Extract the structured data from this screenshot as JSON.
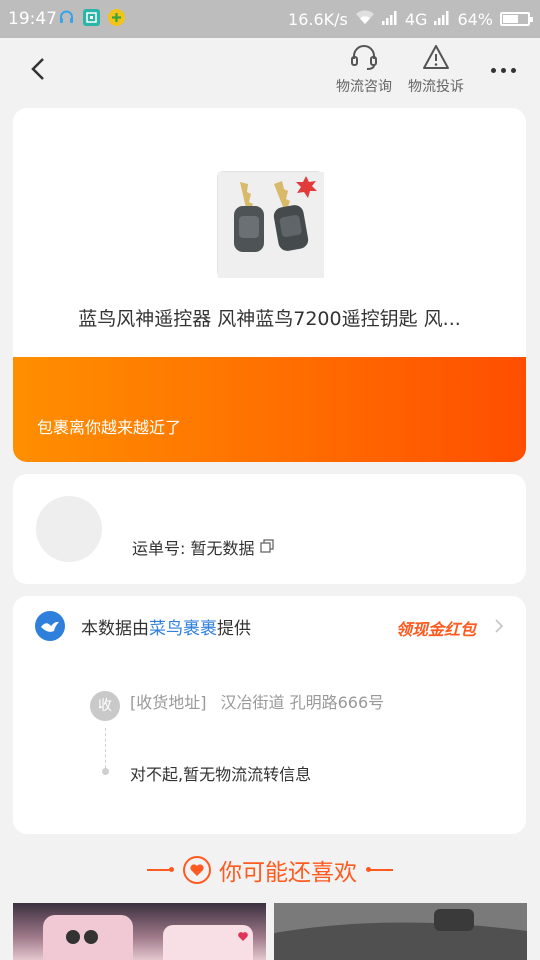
{
  "status_bar": {
    "time": "19:47",
    "speed": "16.6K/s",
    "network": "4G",
    "battery": "64%",
    "battery_level": 0.64
  },
  "nav": {
    "consult_label": "物流咨询",
    "complaint_label": "物流投诉"
  },
  "package": {
    "title": "蓝鸟风神遥控器 风神蓝鸟7200遥控钥匙 风...",
    "banner_text": "包裹离你越来越近了"
  },
  "waybill": {
    "label": "运单号: 暂无数据"
  },
  "provider": {
    "prefix": "本数据由",
    "name": "菜鸟裹裹",
    "suffix": "提供",
    "promo": "领现金红包"
  },
  "tracking": {
    "badge": "收",
    "address_label": "[收货地址]",
    "address_value": "汉冶街道 孔明路666号",
    "no_info": "对不起,暂无物流流转信息"
  },
  "recommend": {
    "title": "你可能还喜欢"
  },
  "colors": {
    "accent": "#ff5a1f",
    "provider_blue": "#2f7fdc"
  }
}
